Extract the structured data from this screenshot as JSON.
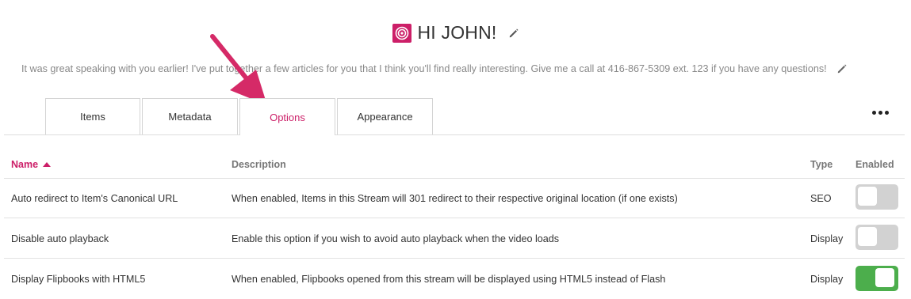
{
  "header": {
    "title": "HI JOHN!",
    "logo_icon": "target-icon",
    "edit_icon": "pencil-icon"
  },
  "message": {
    "text": "It was great speaking with you earlier! I've put together a few articles for you that I think you'll find really interesting. Give me a call at 416-867-5309 ext. 123 if you have any questions!",
    "edit_icon": "pencil-icon"
  },
  "tabs": [
    {
      "label": "Items",
      "active": false
    },
    {
      "label": "Metadata",
      "active": false
    },
    {
      "label": "Options",
      "active": true
    },
    {
      "label": "Appearance",
      "active": false
    }
  ],
  "more_icon": "ellipsis-icon",
  "table": {
    "headers": {
      "name": "Name",
      "description": "Description",
      "type": "Type",
      "enabled": "Enabled"
    },
    "sort": {
      "column": "name",
      "direction": "ascending"
    },
    "rows": [
      {
        "name": "Auto redirect to Item's Canonical URL",
        "description": "When enabled, Items in this Stream will 301 redirect to their respective original location (if one exists)",
        "type": "SEO",
        "enabled": false
      },
      {
        "name": "Disable auto playback",
        "description": "Enable this option if you wish to avoid auto playback when the video loads",
        "type": "Display",
        "enabled": false
      },
      {
        "name": "Display Flipbooks with HTML5",
        "description": "When enabled, Flipbooks opened from this stream will be displayed using HTML5 instead of Flash",
        "type": "Display",
        "enabled": true
      }
    ]
  },
  "colors": {
    "accent": "#cc1f68",
    "toggle_on": "#4cae4c",
    "toggle_off": "#d2d2d2"
  }
}
